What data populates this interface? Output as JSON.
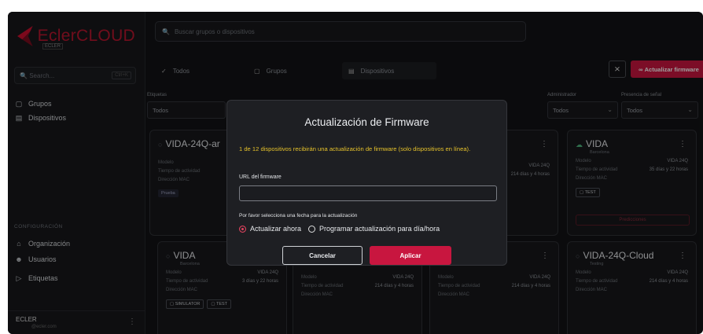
{
  "app": {
    "logo_text": "EclerCLOUD",
    "logo_sub": "ECLER"
  },
  "sidebar": {
    "search_placeholder": "Search...",
    "search_shortcut": "Ctrl+K",
    "items": [
      {
        "label": "Grupos",
        "icon": "folder-icon"
      },
      {
        "label": "Dispositivos",
        "icon": "device-icon"
      }
    ],
    "config_label": "CONFIGURACIÓN",
    "config_items": [
      {
        "label": "Organización",
        "icon": "home-icon"
      },
      {
        "label": "Usuarios",
        "icon": "users-icon"
      },
      {
        "label": "Etiquetas",
        "icon": "tag-icon"
      }
    ],
    "footer": {
      "name": "ECLER",
      "email": "@ecler.com"
    }
  },
  "top_search_placeholder": "Buscar grupos o dispositivos",
  "tabs": [
    "Todos",
    "Grupos",
    "Dispositivos"
  ],
  "actions": {
    "firmware_button": "Actualizar firmware"
  },
  "filters": [
    {
      "label": "Etiquetas",
      "value": "Todos"
    },
    {
      "label": "Administrador",
      "value": "Todos"
    },
    {
      "label": "Presencia de señal",
      "value": "Todos"
    }
  ],
  "cards": [
    {
      "title": "VIDA-24Q-ar",
      "subtitle": "",
      "rows": [
        [
          "Modelo",
          ""
        ],
        [
          "Tiempo de actividad",
          ""
        ],
        [
          "Dirección MAC",
          ""
        ]
      ],
      "tags": [
        "Prueba"
      ]
    },
    {
      "title": "",
      "subtitle": "",
      "rows": [
        [
          "",
          "VIDA 24Q"
        ],
        [
          "",
          "214 días y 4 horas"
        ]
      ],
      "tags": []
    },
    {
      "title": "VIDA",
      "subtitle": "Barcelona",
      "rows": [
        [
          "Modelo",
          "VIDA 24Q"
        ],
        [
          "Tiempo de actividad",
          "35 días y 22 horas"
        ],
        [
          "Dirección MAC",
          ""
        ]
      ],
      "tags": [
        "TEST"
      ],
      "wide_button": "Predicciones"
    },
    {
      "title": "VIDA",
      "subtitle": "Barcelona",
      "rows": [
        [
          "Modelo",
          "VIDA 24Q"
        ],
        [
          "Tiempo de actividad",
          "3 días y 22 horas"
        ],
        [
          "Dirección MAC",
          ""
        ]
      ],
      "tags": [
        "SIMULATOR",
        "TEST"
      ]
    },
    {
      "title": "",
      "subtitle": "",
      "rows": [
        [
          "Modelo",
          "VIDA 24Q"
        ],
        [
          "Tiempo de actividad",
          "214 días y 4 horas"
        ],
        [
          "Dirección MAC",
          ""
        ]
      ],
      "tags": []
    },
    {
      "title": "",
      "subtitle": "",
      "rows": [
        [
          "Modelo",
          "VIDA 24Q"
        ],
        [
          "Tiempo de actividad",
          "214 días y 4 horas"
        ],
        [
          "Dirección MAC",
          ""
        ]
      ],
      "tags": []
    },
    {
      "title": "VIDA-24Q-Cloud",
      "subtitle": "Testing",
      "rows": [
        [
          "Modelo",
          "VIDA 24Q"
        ],
        [
          "Tiempo de actividad",
          "214 días y 4 horas"
        ],
        [
          "Dirección MAC",
          ""
        ]
      ],
      "tags": []
    }
  ],
  "modal": {
    "title": "Actualización de Firmware",
    "warning": "1 de 12 dispositivos recibirán una actualización de firmware (solo dispositivos en línea).",
    "url_label": "URL del firmware",
    "url_value": "",
    "date_prompt": "Por favor selecciona una fecha para la actualización",
    "option_now": "Actualizar ahora",
    "option_schedule": "Programar actualización para día/hora",
    "cancel": "Cancelar",
    "apply": "Aplicar"
  },
  "colors": {
    "accent": "#c8163f",
    "warning": "#e6c22b",
    "background": "#121315"
  }
}
